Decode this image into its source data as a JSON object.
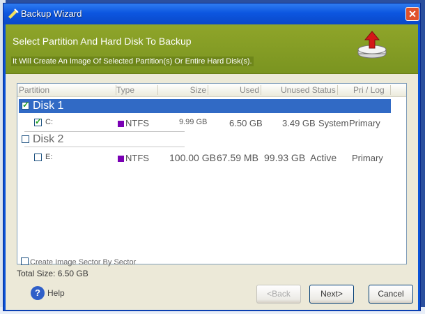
{
  "window": {
    "title": "Backup Wizard",
    "close_glyph": "✕"
  },
  "header": {
    "title": "Select Partition And Hard Disk To Backup",
    "subtitle": "It Will Create An Image Of Selected Partition(s) Or Entire Hard Disk(s)."
  },
  "columns": [
    "Partition",
    "Type",
    "Size",
    "Used",
    "Unused Status",
    "Pri / Log"
  ],
  "disks": [
    {
      "label": "Disk 1",
      "checked": true,
      "selected": true,
      "partitions": [
        {
          "name": "C:",
          "type": "NTFS",
          "size": "9.99 GB",
          "used": "6.50 GB",
          "unused": "3.49 GB",
          "status": "System",
          "pri_log": "Primary",
          "checked": true
        }
      ]
    },
    {
      "label": "Disk 2",
      "checked": false,
      "selected": false,
      "partitions": [
        {
          "name": "E:",
          "type": "NTFS",
          "size": "100.00 GB",
          "used": "67.59 MB",
          "unused": "99.93 GB",
          "status": "Active",
          "pri_log": "Primary",
          "checked": false
        }
      ]
    }
  ],
  "options": {
    "sector_by_sector": "Create Image Sector By Sector",
    "sector_checked": false
  },
  "summary": {
    "total_size": "Total Size: 6.50 GB"
  },
  "buttons": {
    "help": "Help",
    "back": "<Back",
    "next": "Next>",
    "cancel": "Cancel"
  },
  "colors": {
    "title_bar": "#0c56e0",
    "header_band": "#7a9420",
    "selection": "#316ac5",
    "ntfs": "#7a00b4"
  }
}
